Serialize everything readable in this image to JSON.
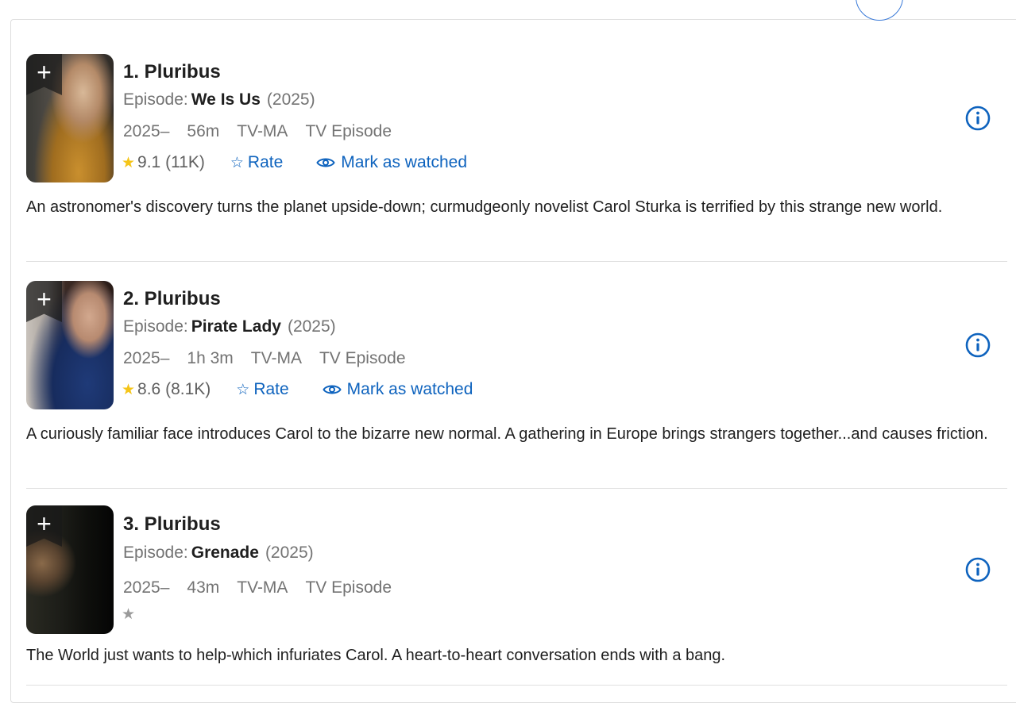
{
  "list": {
    "items": [
      {
        "title": "1. Pluribus",
        "episode_label": "Episode:",
        "episode_name": "We Is Us",
        "episode_year": "(2025)",
        "years": "2025–",
        "runtime": "56m",
        "certificate": "TV-MA",
        "type": "TV Episode",
        "rating": "9.1 (11K)",
        "rate_label": "Rate",
        "watched_label": "Mark as watched",
        "description": "An astronomer's discovery turns the planet upside-down; curmudgeonly novelist Carol Sturka is terrified by this strange new world."
      },
      {
        "title": "2. Pluribus",
        "episode_label": "Episode:",
        "episode_name": "Pirate Lady",
        "episode_year": "(2025)",
        "years": "2025–",
        "runtime": "1h 3m",
        "certificate": "TV-MA",
        "type": "TV Episode",
        "rating": "8.6 (8.1K)",
        "rate_label": "Rate",
        "watched_label": "Mark as watched",
        "description": "A curiously familiar face introduces Carol to the bizarre new normal. A gathering in Europe brings strangers together...and causes friction."
      },
      {
        "title": "3. Pluribus",
        "episode_label": "Episode:",
        "episode_name": "Grenade",
        "episode_year": "(2025)",
        "years": "2025–",
        "runtime": "43m",
        "certificate": "TV-MA",
        "type": "TV Episode",
        "description": "The World just wants to help-which infuriates Carol. A heart-to-heart conversation ends with a bang."
      }
    ]
  },
  "icons": {
    "add": "+",
    "star": "star-icon",
    "rate": "star-outline-icon",
    "watched": "eye-icon",
    "info": "info-icon"
  },
  "colors": {
    "link": "#0e63be",
    "star_gold": "#f5c518",
    "muted": "#737373"
  }
}
